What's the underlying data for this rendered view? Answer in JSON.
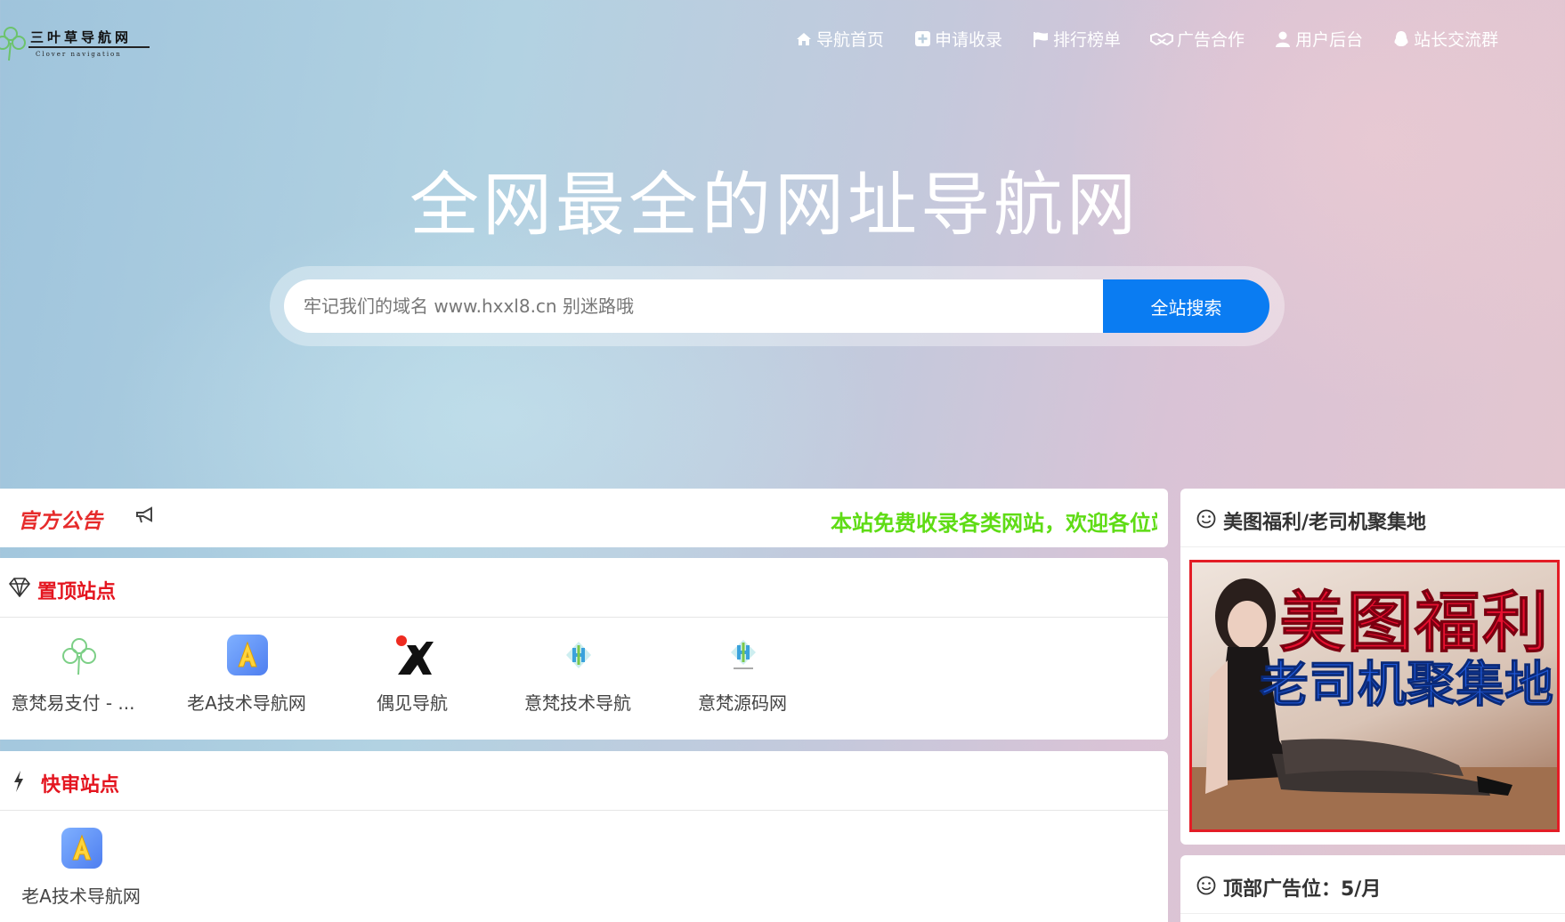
{
  "brand": {
    "title": "三叶草导航网",
    "subtitle": "Clover navigation"
  },
  "nav": [
    {
      "label": "导航首页",
      "icon": "home-icon"
    },
    {
      "label": "申请收录",
      "icon": "plus-square-icon"
    },
    {
      "label": "排行榜单",
      "icon": "flag-icon"
    },
    {
      "label": "广告合作",
      "icon": "handshake-icon"
    },
    {
      "label": "用户后台",
      "icon": "user-icon"
    },
    {
      "label": "站长交流群",
      "icon": "qq-icon"
    }
  ],
  "hero": {
    "title": "全网最全的网址导航网"
  },
  "search": {
    "placeholder": "牢记我们的域名 www.hxxl8.cn 别迷路哦",
    "button_label": "全站搜索"
  },
  "notice": {
    "title": "官方公告",
    "icon": "megaphone-icon",
    "text": "本站免费收录各类网站，欢迎各位站长提交收录"
  },
  "top_sites": {
    "title": "置顶站点",
    "icon": "diamond-icon",
    "items": [
      {
        "name": "意梵易支付 - ...",
        "icon": "clover-icon"
      },
      {
        "name": "老A技术导航网",
        "icon": "letter-a-icon"
      },
      {
        "name": "偶见导航",
        "icon": "k-logo-icon"
      },
      {
        "name": "意梵技术导航",
        "icon": "yf-logo-icon"
      },
      {
        "name": "意梵源码网",
        "icon": "yf-logo-icon"
      }
    ]
  },
  "fast_sites": {
    "title": "快审站点",
    "icon": "bolt-icon",
    "items": [
      {
        "name": "老A技术导航网",
        "icon": "letter-a-icon"
      }
    ]
  },
  "sidebar": {
    "ad_panel": {
      "title": "美图福利/老司机聚集地",
      "icon": "smile-icon",
      "banner_line1": "美图福利",
      "banner_line2": "老司机聚集地"
    },
    "ad_panel2": {
      "title": "顶部广告位：5/月",
      "icon": "smile-icon"
    }
  },
  "colors": {
    "accent": "#0a7cf2",
    "notice_red": "#e62b2b",
    "section_red": "#e4151f",
    "marquee_green": "#5fdc15"
  }
}
